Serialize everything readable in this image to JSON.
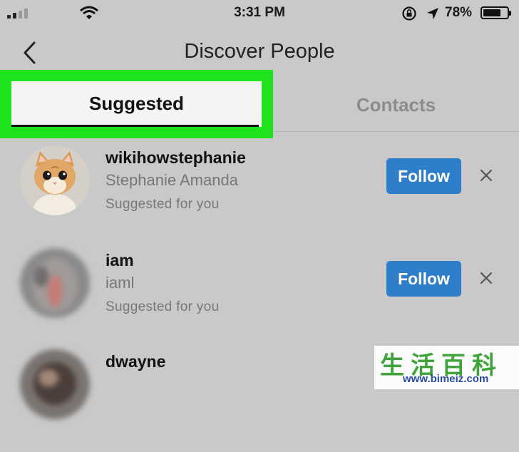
{
  "status_bar": {
    "time": "3:31 PM",
    "battery_percent": "78%",
    "battery_level": 0.78,
    "signal_bars": 2,
    "icons": [
      "signal-icon",
      "wifi-icon",
      "orientation-lock-icon",
      "location-arrow-icon",
      "battery-icon"
    ]
  },
  "nav": {
    "title": "Discover People",
    "back_icon": "chevron-left-icon"
  },
  "tabs": [
    {
      "label": "Suggested",
      "active": true
    },
    {
      "label": "Contacts",
      "active": false
    }
  ],
  "highlight_color": "#1fe21f",
  "accent_color": "#2e7ec9",
  "suggestions": [
    {
      "username": "wikihowstephanie",
      "full_name": "Stephanie Amanda",
      "subtitle": "Suggested for you",
      "follow_label": "Follow",
      "dismiss_icon": "close-icon"
    },
    {
      "username": "iam",
      "full_name": "iaml",
      "subtitle": "Suggested for you",
      "follow_label": "Follow",
      "dismiss_icon": "close-icon"
    },
    {
      "username": "dwayne",
      "full_name": "",
      "subtitle": "",
      "follow_label": "",
      "dismiss_icon": ""
    }
  ],
  "watermark": {
    "chars": "生活百科",
    "url": "www.bimeiz.com"
  }
}
